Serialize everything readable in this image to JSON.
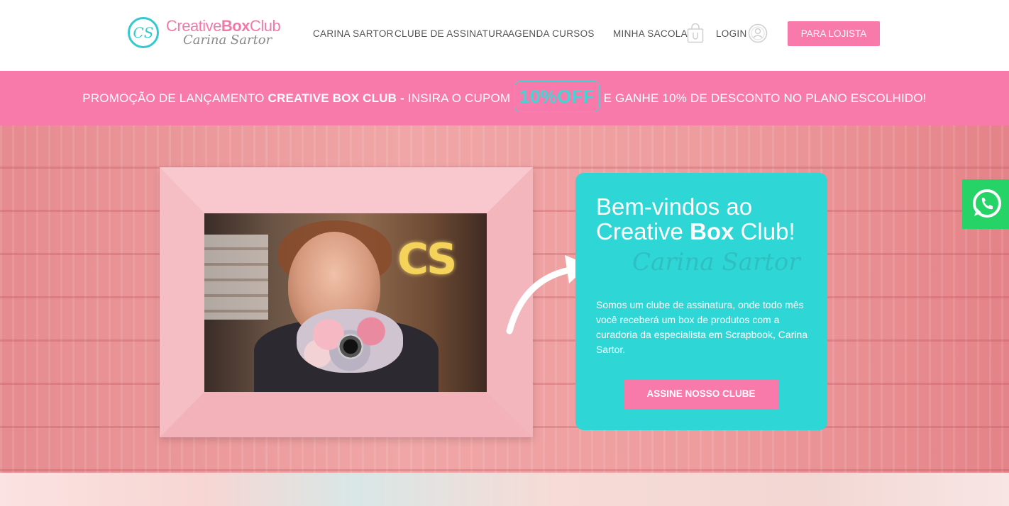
{
  "header": {
    "logo_text_1": "Creative",
    "logo_text_2": "Box",
    "logo_text_3": "Club",
    "logo_mark": "CS",
    "logo_sub": "Carina Sartor",
    "nav": {
      "carina": "CARINA SARTOR",
      "clube": "CLUBE DE ASSINATURA",
      "agenda": "AGENDA CURSOS",
      "sacola": "MINHA SACOLA",
      "login": "LOGIN"
    },
    "lojista_label": "PARA LOJISTA"
  },
  "promo": {
    "prefix": "PROMOÇÃO DE LANÇAMENTO ",
    "brand": "CREATIVE BOX CLUB - ",
    "middle": "INSIRA O CUPOM",
    "coupon": "10%OFF",
    "suffix": "E GANHE 10% DE DESCONTO NO PLANO ESCOLHIDO!"
  },
  "hero": {
    "photo_sign": "CS",
    "card": {
      "title_line1": "Bem-vindos ao",
      "title_line2_pre": "Creative ",
      "title_line2_bold": "Box",
      "title_line2_post": " Club!",
      "signature": "Carina Sartor",
      "text": "Somos um clube de assinatura, onde todo mês você receberá um box de produtos com a curadoria da especialista em Scrapbook, Carina Sartor.",
      "button_label": "ASSINE NOSSO CLUBE"
    }
  },
  "colors": {
    "pink": "#f77aab",
    "teal": "#2ed6d5",
    "whatsapp_green": "#25d366"
  },
  "icons": [
    "bag-icon",
    "user-icon",
    "whatsapp-icon",
    "arrow-icon"
  ]
}
